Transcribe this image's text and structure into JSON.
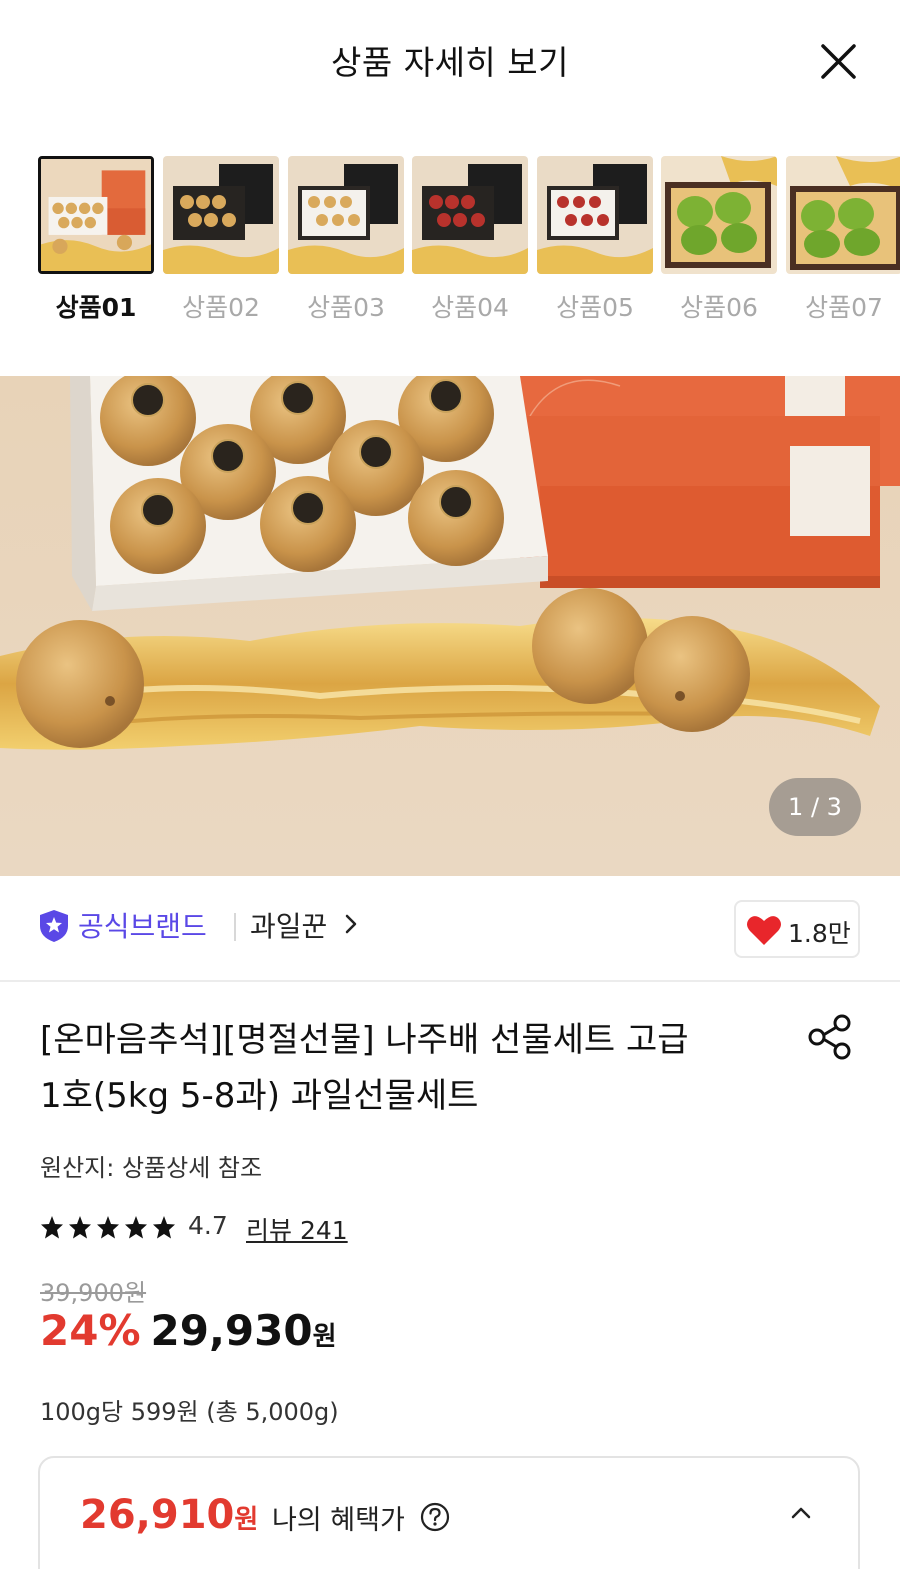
{
  "header": {
    "title": "상품 자세히 보기"
  },
  "thumbnails": [
    {
      "label": "상품01",
      "selected": true
    },
    {
      "label": "상품02",
      "selected": false
    },
    {
      "label": "상품03",
      "selected": false
    },
    {
      "label": "상품04",
      "selected": false
    },
    {
      "label": "상품05",
      "selected": false
    },
    {
      "label": "상품06",
      "selected": false
    },
    {
      "label": "상품07",
      "selected": false
    }
  ],
  "gallery": {
    "counter": "1 / 3"
  },
  "brand": {
    "official_label": "공식브랜드",
    "name": "과일꾼"
  },
  "like": {
    "count": "1.8만"
  },
  "product": {
    "title_line1": "[온마음추석][명절선물] 나주배 선물세트 고급",
    "title_line2": "1호(5kg 5-8과) 과일선물세트",
    "origin": "원산지: 상품상세 참조",
    "rating": "4.7",
    "review_label": "리뷰 241",
    "original_price": "39,900원",
    "discount": "24%",
    "price": "29,930",
    "price_unit": "원",
    "unit_price": "100g당 599원 (총 5,000g)"
  },
  "benefit": {
    "price": "26,910",
    "unit": "원",
    "label": "나의 혜택가"
  },
  "colors": {
    "accent_red": "#e23a2f",
    "brand_purple": "#5a48e6"
  }
}
